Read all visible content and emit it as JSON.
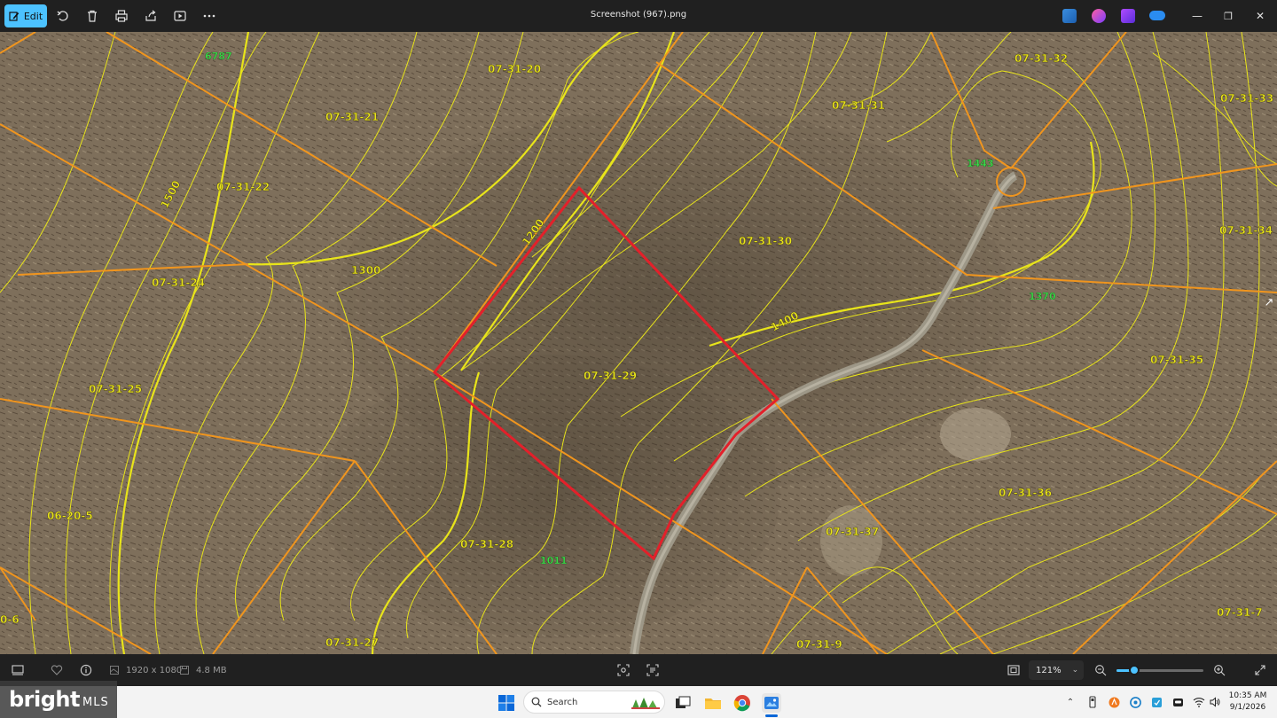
{
  "window": {
    "title": "Screenshot (967).png",
    "edit_label": "Edit",
    "accent": "#4cc2ff"
  },
  "toolbar": {
    "icons": [
      "edit-icon",
      "rotate-icon",
      "delete-icon",
      "print-icon",
      "share-icon",
      "slideshow-icon",
      "more-icon"
    ]
  },
  "map": {
    "parcel_labels": [
      "07-31-20",
      "07-31-21",
      "07-31-22",
      "07-31-24",
      "07-31-25",
      "06-20-5",
      "07-31-28",
      "07-31-27",
      "07-31-29",
      "07-31-30",
      "07-31-31",
      "07-31-32",
      "07-31-33",
      "07-31-34",
      "07-31-35",
      "07-31-36",
      "07-31-37",
      "07-31-9",
      "07-31-7",
      "0-6"
    ],
    "contour_labels": [
      "1500",
      "1300",
      "1200",
      "1400"
    ],
    "address_labels": [
      "6787",
      "1443",
      "1370",
      "1011"
    ],
    "colors": {
      "parcel_line": "#f0951e",
      "contour": "#e8e41a",
      "subject_parcel": "#e3202a",
      "address": "#3cd84a",
      "road": "#9d9787"
    }
  },
  "status": {
    "dimensions": "1920 x 1080",
    "file_size": "4.8 MB",
    "zoom": "121%",
    "zoom_fraction": 0.2
  },
  "taskbar": {
    "watermark_main": "bright",
    "watermark_sub": "MLS",
    "search_placeholder": "Search",
    "time": "10:35 AM",
    "date": "9/1/2026"
  }
}
